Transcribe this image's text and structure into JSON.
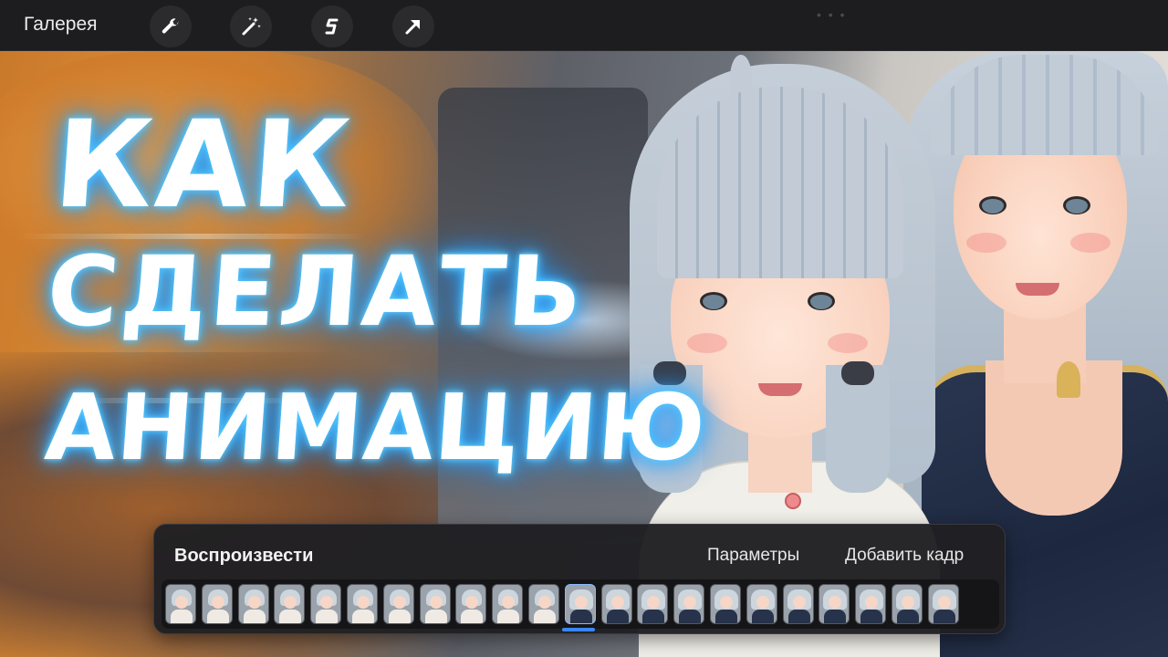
{
  "topbar": {
    "gallery_label": "Галерея",
    "tools": [
      "wrench-icon",
      "magic-wand-icon",
      "selection-s-icon",
      "transform-arrow-icon"
    ]
  },
  "thumbnail_title": {
    "line1": "КАК",
    "line2": "СДЕЛАТЬ",
    "line3": "АНИМАЦИЮ"
  },
  "animation_assist": {
    "play_label": "Воспроизвести",
    "settings_label": "Параметры",
    "add_frame_label": "Добавить кадр",
    "current_frame_index": 11,
    "frames": [
      {
        "style": "sketch"
      },
      {
        "style": "sketch"
      },
      {
        "style": "sketch"
      },
      {
        "style": "sketch"
      },
      {
        "style": "sketch"
      },
      {
        "style": "sketch"
      },
      {
        "style": "sketch"
      },
      {
        "style": "sketch"
      },
      {
        "style": "sketch"
      },
      {
        "style": "sketch"
      },
      {
        "style": "sketch"
      },
      {
        "style": "colored"
      },
      {
        "style": "colored"
      },
      {
        "style": "colored"
      },
      {
        "style": "colored"
      },
      {
        "style": "colored"
      },
      {
        "style": "colored"
      },
      {
        "style": "colored"
      },
      {
        "style": "colored"
      },
      {
        "style": "colored"
      },
      {
        "style": "colored"
      },
      {
        "style": "colored"
      }
    ]
  },
  "colors": {
    "title_glow": "#2aa6ff",
    "panel_bg": "#202023",
    "accent_marker": "#3a86ff"
  }
}
